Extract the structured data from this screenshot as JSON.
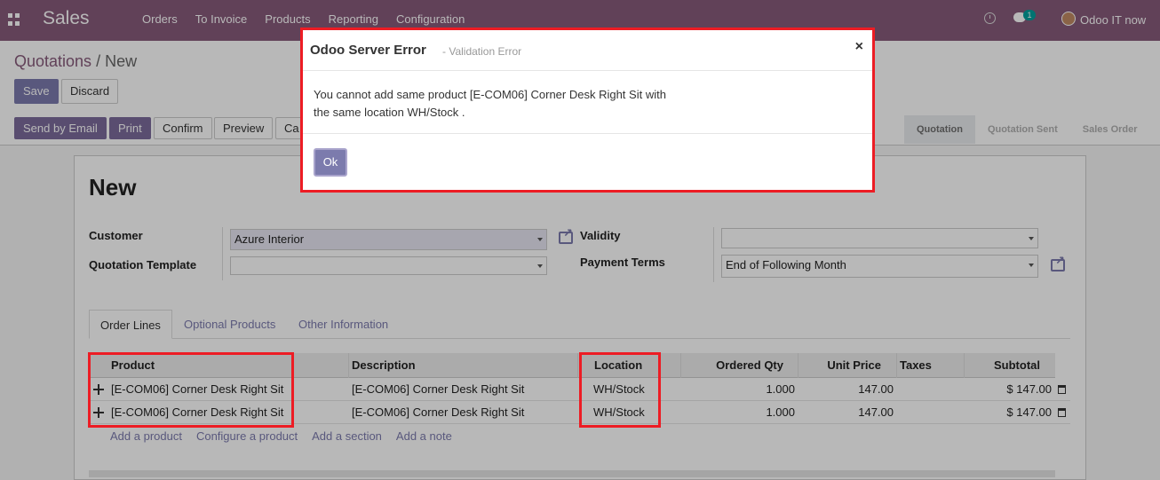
{
  "navbar": {
    "app_title": "Sales",
    "menu": [
      "Orders",
      "To Invoice",
      "Products",
      "Reporting",
      "Configuration"
    ],
    "chat_badge": "1",
    "user_name": "Odoo IT now",
    "color": "#875a7b"
  },
  "breadcrumb": {
    "parent": "Quotations",
    "separator": "/",
    "current": "New"
  },
  "form_buttons": {
    "save": "Save",
    "discard": "Discard"
  },
  "action_buttons": {
    "send_email": "Send by Email",
    "print": "Print",
    "confirm": "Confirm",
    "preview": "Preview",
    "cancel": "Ca"
  },
  "statusbar": [
    "Quotation",
    "Quotation Sent",
    "Sales Order"
  ],
  "form": {
    "title": "New",
    "customer_label": "Customer",
    "customer_value": "Azure Interior",
    "template_label": "Quotation Template",
    "template_value": "",
    "validity_label": "Validity",
    "validity_value": "",
    "payment_terms_label": "Payment Terms",
    "payment_terms_value": "End of Following Month"
  },
  "tabs": [
    "Order Lines",
    "Optional Products",
    "Other Information"
  ],
  "table": {
    "headers": {
      "product": "Product",
      "description": "Description",
      "location": "Location",
      "ordered_qty": "Ordered Qty",
      "unit_price": "Unit Price",
      "taxes": "Taxes",
      "subtotal": "Subtotal"
    },
    "rows": [
      {
        "product": "[E-COM06] Corner Desk Right Sit",
        "description": "[E-COM06] Corner Desk Right Sit",
        "location": "WH/Stock",
        "qty": "1.000",
        "price": "147.00",
        "taxes": "",
        "subtotal": "$ 147.00"
      },
      {
        "product": "[E-COM06] Corner Desk Right Sit",
        "description": "[E-COM06] Corner Desk Right Sit",
        "location": "WH/Stock",
        "qty": "1.000",
        "price": "147.00",
        "taxes": "",
        "subtotal": "$ 147.00"
      }
    ],
    "add_links": [
      "Add a product",
      "Configure a product",
      "Add a section",
      "Add a note"
    ]
  },
  "modal": {
    "title": "Odoo Server Error",
    "subtitle": "- Validation Error",
    "close": "×",
    "message_line1": "You cannot add same product [E-COM06] Corner Desk Right Sit with",
    "message_line2": "the same location WH/Stock .",
    "ok": "Ok"
  },
  "colors": {
    "accent": "#7c7bad",
    "highlight": "#ed1c24"
  }
}
